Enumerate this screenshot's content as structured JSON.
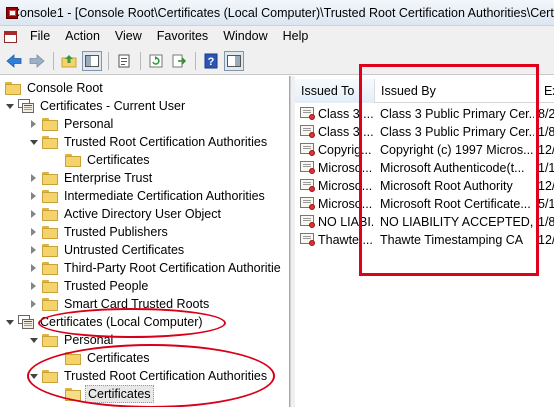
{
  "window": {
    "title": "Console1 - [Console Root\\Certificates (Local Computer)\\Trusted Root Certification Authorities\\Certif"
  },
  "menu": [
    "File",
    "Action",
    "View",
    "Favorites",
    "Window",
    "Help"
  ],
  "toolbar": {
    "buttons": [
      "back-icon",
      "forward-icon",
      "up-folder-icon",
      "show-hide-tree-icon",
      "properties-icon",
      "refresh-icon",
      "export-list-icon",
      "help-icon",
      "action-pane-icon"
    ]
  },
  "tree": {
    "items": [
      {
        "label": "Console Root",
        "icon": "folder",
        "expander": "none",
        "indent": 0
      },
      {
        "label": "Certificates - Current User",
        "icon": "cert-store",
        "expander": "open",
        "indent": 1
      },
      {
        "label": "Personal",
        "icon": "folder",
        "expander": "closed",
        "indent": 2
      },
      {
        "label": "Trusted Root Certification Authorities",
        "icon": "folder",
        "expander": "open",
        "indent": 2
      },
      {
        "label": "Certificates",
        "icon": "folder",
        "expander": "none",
        "indent": 3
      },
      {
        "label": "Enterprise Trust",
        "icon": "folder",
        "expander": "closed",
        "indent": 2
      },
      {
        "label": "Intermediate Certification Authorities",
        "icon": "folder",
        "expander": "closed",
        "indent": 2
      },
      {
        "label": "Active Directory User Object",
        "icon": "folder",
        "expander": "closed",
        "indent": 2
      },
      {
        "label": "Trusted Publishers",
        "icon": "folder",
        "expander": "closed",
        "indent": 2
      },
      {
        "label": "Untrusted Certificates",
        "icon": "folder",
        "expander": "closed",
        "indent": 2
      },
      {
        "label": "Third-Party Root Certification Authoritie",
        "icon": "folder",
        "expander": "closed",
        "indent": 2
      },
      {
        "label": "Trusted People",
        "icon": "folder",
        "expander": "closed",
        "indent": 2
      },
      {
        "label": "Smart Card Trusted Roots",
        "icon": "folder",
        "expander": "closed",
        "indent": 2
      },
      {
        "label": "Certificates (Local Computer)",
        "icon": "cert-store",
        "expander": "open",
        "indent": 1
      },
      {
        "label": "Personal",
        "icon": "folder",
        "expander": "open",
        "indent": 2
      },
      {
        "label": "Certificates",
        "icon": "folder",
        "expander": "none",
        "indent": 3
      },
      {
        "label": "Trusted Root Certification Authorities",
        "icon": "folder",
        "expander": "open",
        "indent": 2
      },
      {
        "label": "Certificates",
        "icon": "folder-open",
        "expander": "none",
        "indent": 3,
        "selected": true
      }
    ]
  },
  "list": {
    "columns": [
      "Issued To",
      "Issued By",
      "Exp"
    ],
    "rows": [
      [
        "Class 3 ...",
        "Class 3 Public Primary Cer...",
        "8/2"
      ],
      [
        "Class 3 ...",
        "Class 3 Public Primary Cer...",
        "1/8"
      ],
      [
        "Copyrig...",
        "Copyright (c) 1997 Micros...",
        "12/"
      ],
      [
        "Microso...",
        "Microsoft Authenticode(t...",
        "1/1"
      ],
      [
        "Microso...",
        "Microsoft Root Authority",
        "12/"
      ],
      [
        "Microso...",
        "Microsoft Root Certificate...",
        "5/1"
      ],
      [
        "NO LIABI...",
        "NO LIABILITY ACCEPTED,...",
        "1/8"
      ],
      [
        "Thawte ...",
        "Thawte Timestamping CA",
        "12/"
      ]
    ]
  },
  "colors": {
    "annotation_red": "#e0001a",
    "title_bar": "#dbe6f2"
  }
}
